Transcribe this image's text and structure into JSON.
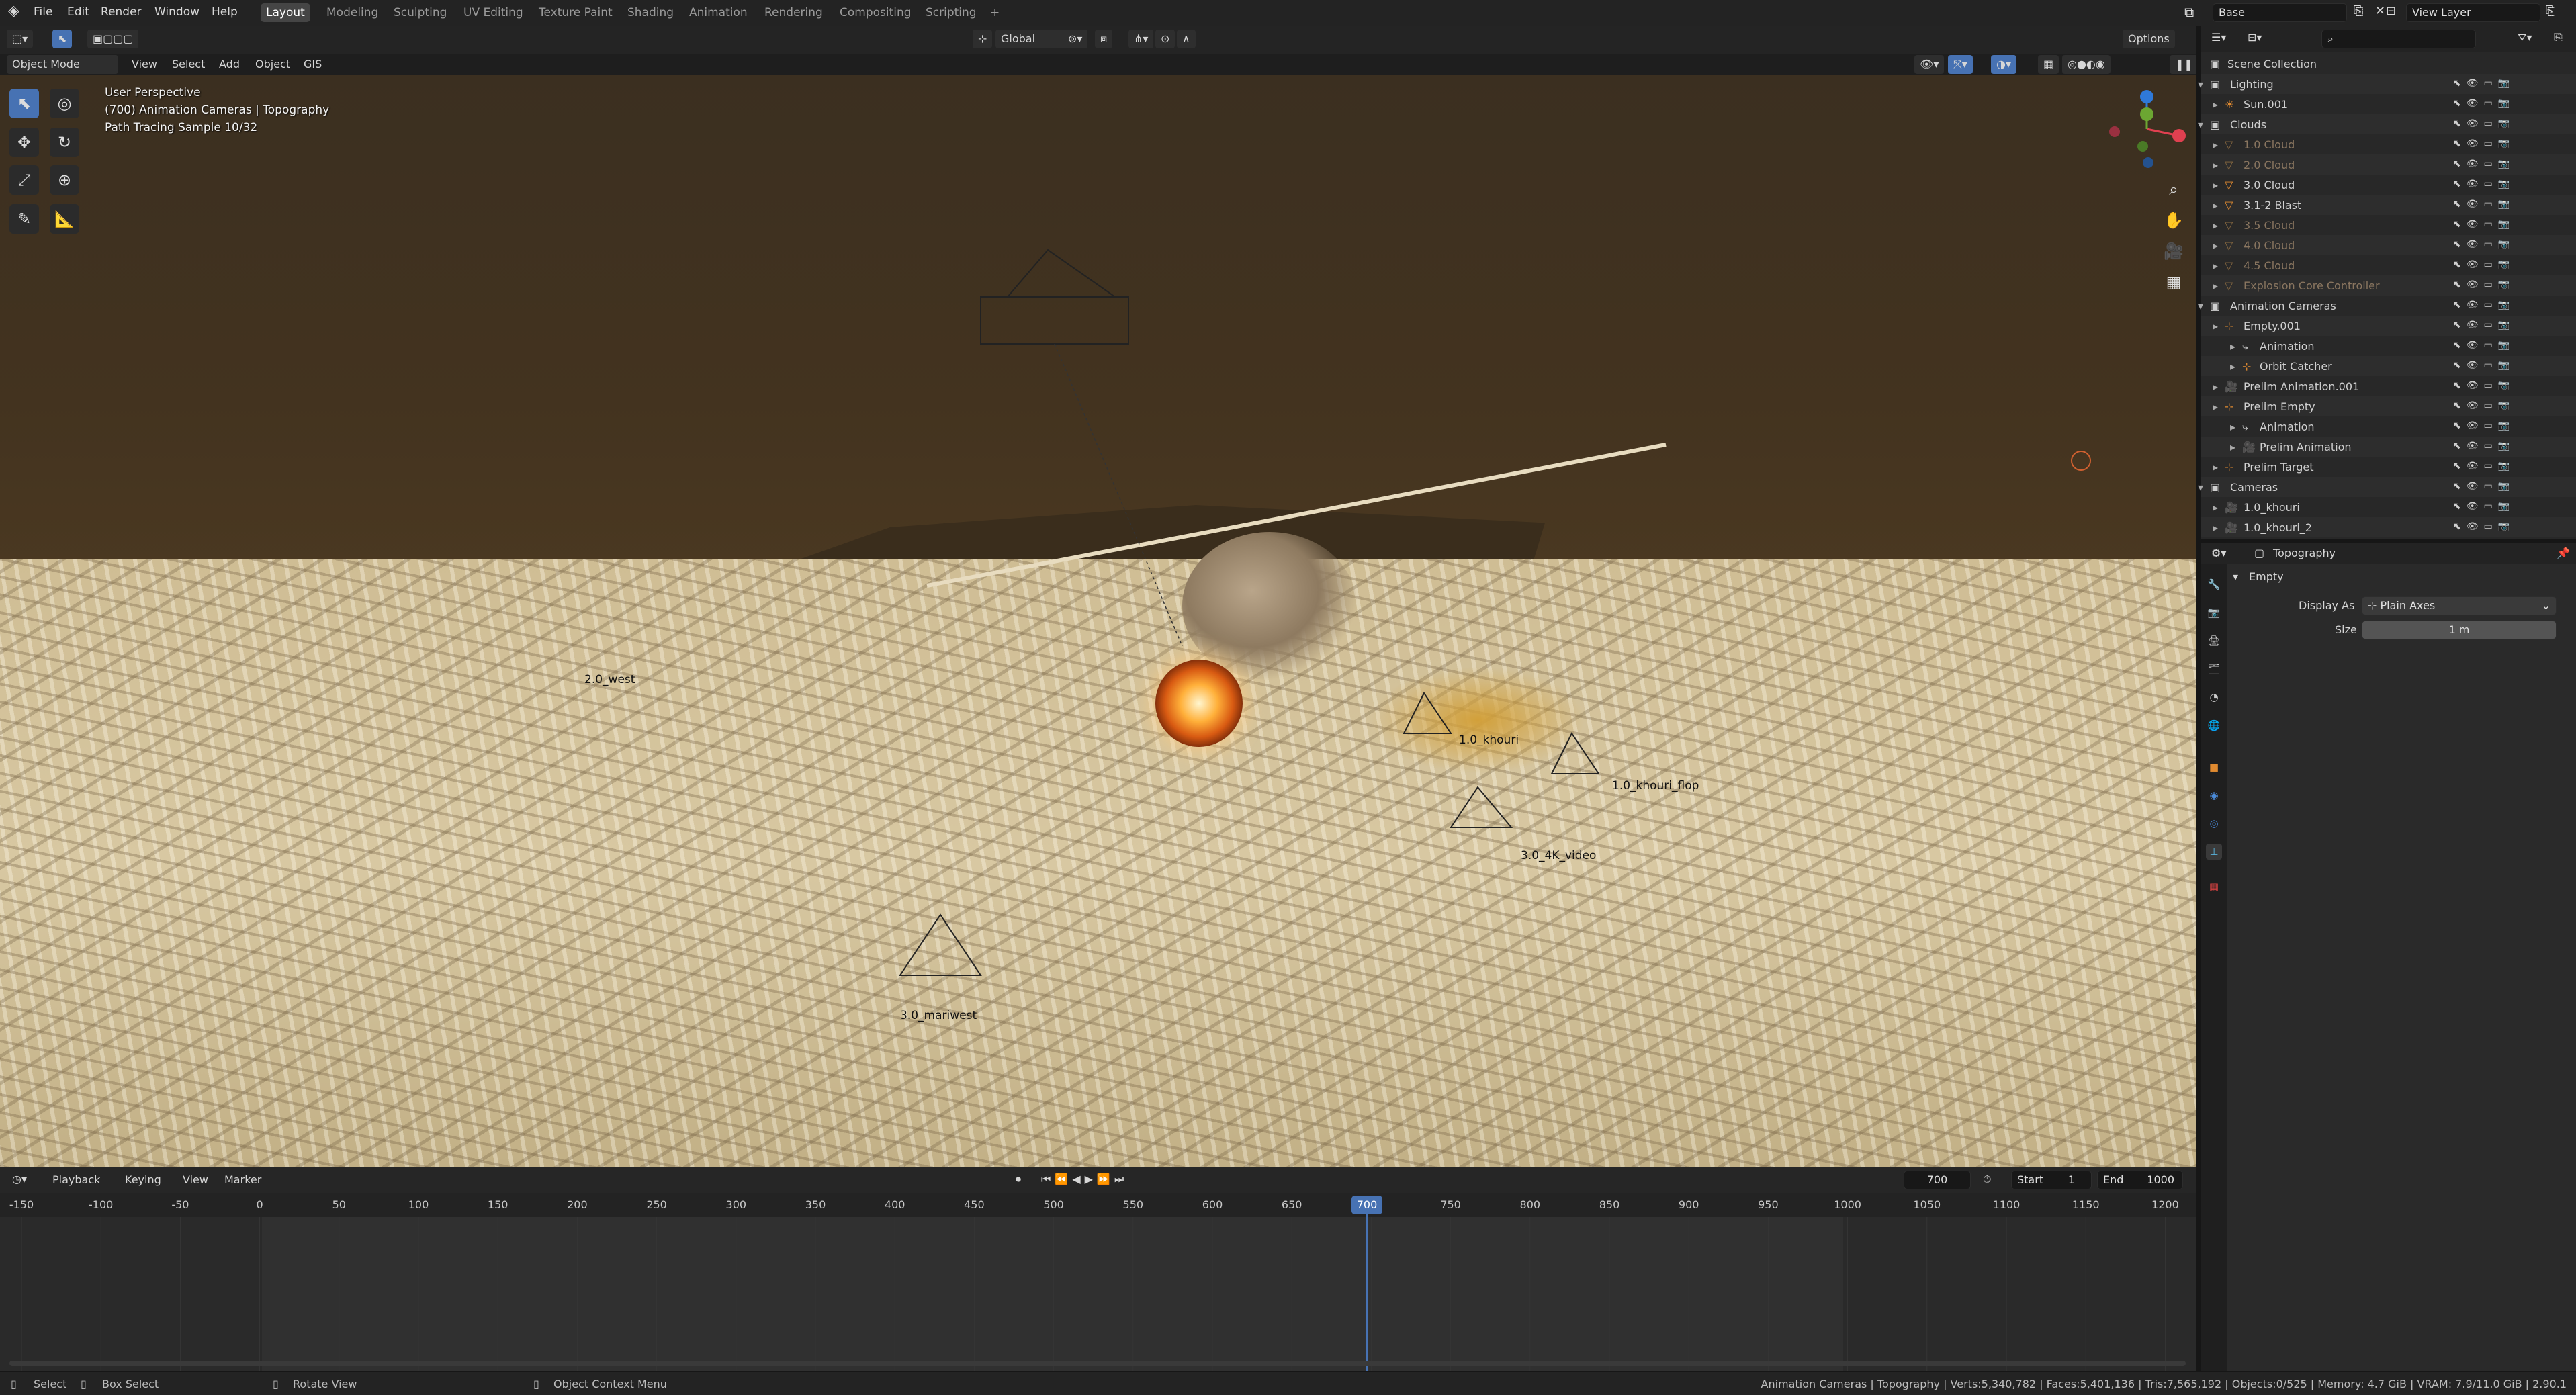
{
  "topbar": {
    "menus": [
      "File",
      "Edit",
      "Render",
      "Window",
      "Help"
    ],
    "workspaces": [
      "Layout",
      "Modeling",
      "Sculpting",
      "UV Editing",
      "Texture Paint",
      "Shading",
      "Animation",
      "Rendering",
      "Compositing",
      "Scripting"
    ],
    "active_workspace": "Layout",
    "add_tab": "+",
    "scene_name": "Base",
    "view_layer": "View Layer"
  },
  "viewport_header": {
    "mode": "Object Mode",
    "menus": [
      "View",
      "Select",
      "Add",
      "Object",
      "GIS"
    ],
    "orientation": "Global",
    "options": "Options"
  },
  "viewport": {
    "perspective": "User Perspective",
    "collection_info": "(700) Animation Cameras | Topography",
    "render_status": "Path Tracing Sample 10/32",
    "camera_labels": [
      "1.0_khouri",
      "1.0_khouri_flop",
      "3.0_4K_video",
      "3.0_mariwest",
      "2.0_west"
    ]
  },
  "timeline": {
    "menus": [
      "Playback",
      "Keying",
      "View",
      "Marker"
    ],
    "current_frame": "700",
    "start_label": "Start",
    "start": "1",
    "end_label": "End",
    "end": "1000",
    "ticks": [
      "-150",
      "-100",
      "-50",
      "0",
      "50",
      "100",
      "150",
      "200",
      "250",
      "300",
      "350",
      "400",
      "450",
      "500",
      "550",
      "600",
      "650",
      "700",
      "750",
      "800",
      "850",
      "900",
      "950",
      "1000",
      "1050",
      "1100",
      "1150",
      "1200"
    ]
  },
  "statusbar": {
    "select": "Select",
    "box_select": "Box Select",
    "rotate_view": "Rotate View",
    "context_menu": "Object Context Menu",
    "stats": "Animation Cameras | Topography | Verts:5,340,782 | Faces:5,401,136 | Tris:7,565,192 | Objects:0/525 | Memory: 4.7 GiB | VRAM: 7.9/11.0 GiB | 2.90.1"
  },
  "outliner": {
    "root": "Scene Collection",
    "rows": [
      {
        "label": "Lighting",
        "kind": "collection"
      },
      {
        "label": "Sun.001",
        "kind": "light"
      },
      {
        "label": "Clouds",
        "kind": "collection"
      },
      {
        "label": "1.0 Cloud",
        "kind": "object-disabled"
      },
      {
        "label": "2.0 Cloud",
        "kind": "object-disabled"
      },
      {
        "label": "3.0 Cloud",
        "kind": "object"
      },
      {
        "label": "3.1-2 Blast",
        "kind": "object"
      },
      {
        "label": "3.5 Cloud",
        "kind": "object-disabled"
      },
      {
        "label": "4.0 Cloud",
        "kind": "object-disabled"
      },
      {
        "label": "4.5 Cloud",
        "kind": "object-disabled"
      },
      {
        "label": "Explosion Core Controller",
        "kind": "object-disabled"
      },
      {
        "label": "Animation Cameras",
        "kind": "collection"
      },
      {
        "label": "Empty.001",
        "kind": "empty"
      },
      {
        "label": "Animation",
        "kind": "action"
      },
      {
        "label": "Orbit Catcher",
        "kind": "empty"
      },
      {
        "label": "Prelim Animation.001",
        "kind": "camera"
      },
      {
        "label": "Prelim Empty",
        "kind": "empty"
      },
      {
        "label": "Animation",
        "kind": "action"
      },
      {
        "label": "Prelim Animation",
        "kind": "camera"
      },
      {
        "label": "Prelim Target",
        "kind": "empty"
      },
      {
        "label": "Cameras",
        "kind": "collection"
      },
      {
        "label": "1.0_khouri",
        "kind": "camera"
      },
      {
        "label": "1.0_khouri_2",
        "kind": "camera"
      }
    ]
  },
  "properties": {
    "object_name": "Topography",
    "panel": "Empty",
    "display_as_label": "Display As",
    "display_as_value": "Plain Axes",
    "size_label": "Size",
    "size_value": "1 m"
  },
  "colors": {
    "accent": "#4772b3",
    "background": "#1d1d1d",
    "panel": "#282828"
  }
}
